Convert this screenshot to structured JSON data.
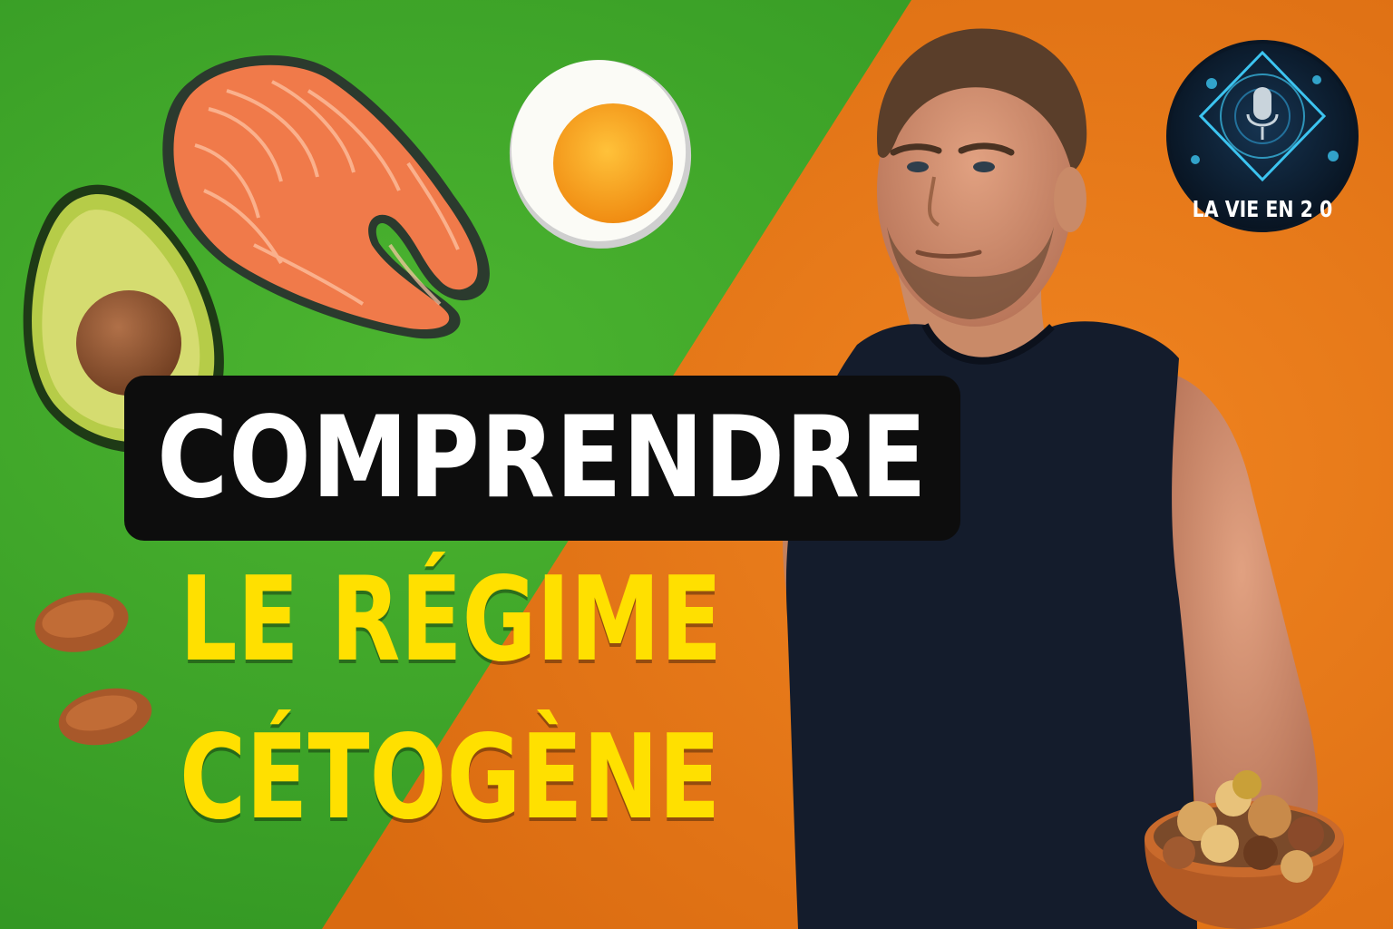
{
  "thumbnail": {
    "headline": "COMPRENDRE",
    "subheadline_line1": "LE RÉGIME",
    "subheadline_line2": "CÉTOGÈNE"
  },
  "logo": {
    "text": "LA VIE EN 2 0",
    "icon": "microphone-icon"
  },
  "colors": {
    "background_green": "#3fa52a",
    "background_orange": "#ec7a17",
    "headline_box": "#0d0d0d",
    "headline_text": "#ffffff",
    "subheadline_text": "#ffe000",
    "logo_background": "#0b1a2a",
    "logo_accent": "#3cc4f0"
  },
  "illustrations": [
    "salmon-steak-icon",
    "boiled-egg-icon",
    "avocado-icon",
    "almond-icon",
    "man-in-tank-top",
    "nut-bowl-icon"
  ]
}
